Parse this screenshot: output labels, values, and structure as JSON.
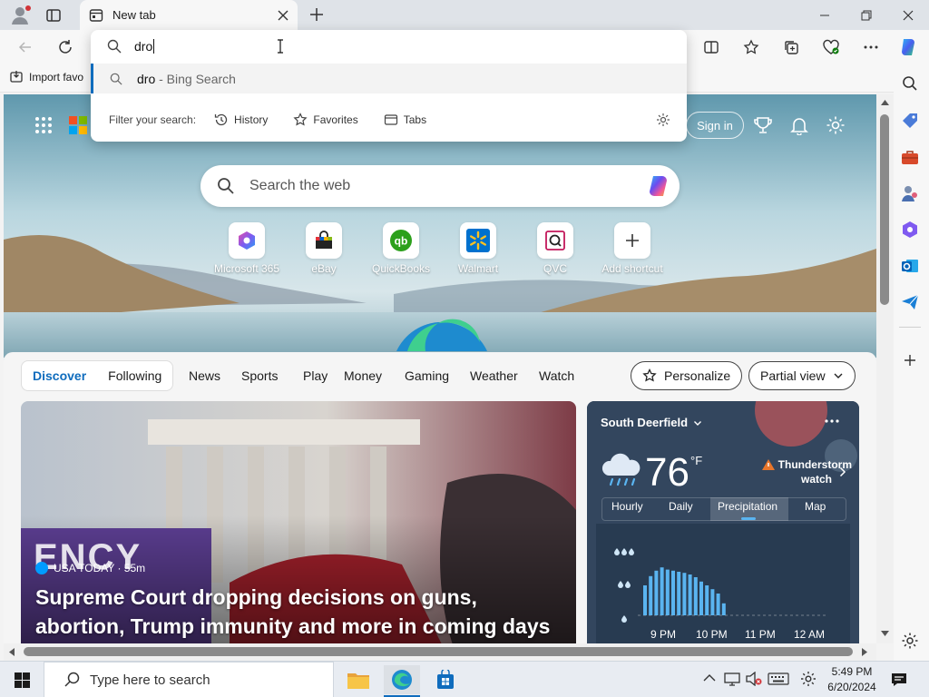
{
  "tab": {
    "title": "New tab"
  },
  "omnibox": {
    "typed": "dro",
    "suggestion_query": "dro",
    "suggestion_source": " - Bing Search",
    "filter_label": "Filter your search:",
    "filters": [
      "History",
      "Favorites",
      "Tabs"
    ]
  },
  "favorites_bar": {
    "import_label": "Import favo"
  },
  "header": {
    "sign_in": "Sign in"
  },
  "search": {
    "placeholder": "Search the web"
  },
  "shortcuts": [
    {
      "label": "Microsoft 365"
    },
    {
      "label": "eBay"
    },
    {
      "label": "QuickBooks"
    },
    {
      "label": "Walmart"
    },
    {
      "label": "QVC"
    },
    {
      "label": "Add shortcut"
    }
  ],
  "feed_nav": {
    "pill": [
      "Discover",
      "Following"
    ],
    "items": [
      "News",
      "Sports",
      "Play",
      "Money",
      "Gaming",
      "Weather",
      "Watch"
    ],
    "personalize": "Personalize",
    "view": "Partial view"
  },
  "news": {
    "source": "USA TODAY · 55m",
    "headline": "Supreme Court dropping decisions on guns, abortion, Trump immunity and more in coming days",
    "image_text": "ENCY"
  },
  "weather": {
    "location": "South Deerfield",
    "temp": "76",
    "unit": "°F",
    "alert_line1": "Thunderstorm",
    "alert_line2": "watch",
    "tabs": [
      "Hourly",
      "Daily",
      "Precipitation",
      "Map"
    ],
    "active_tab": "Precipitation",
    "times": [
      "9 PM",
      "10 PM",
      "11 PM",
      "12 AM"
    ],
    "precip_levels": [
      0.55,
      0.72,
      0.82,
      0.88,
      0.84,
      0.82,
      0.8,
      0.78,
      0.75,
      0.7,
      0.62,
      0.55,
      0.48,
      0.4,
      0.22
    ]
  },
  "taskbar": {
    "search_placeholder": "Type here to search",
    "time": "5:49 PM",
    "date": "6/20/2024"
  },
  "colors": {
    "accent": "#0f6cbd",
    "weather_bar": "#5ab4f0",
    "alert": "#e8762b"
  }
}
